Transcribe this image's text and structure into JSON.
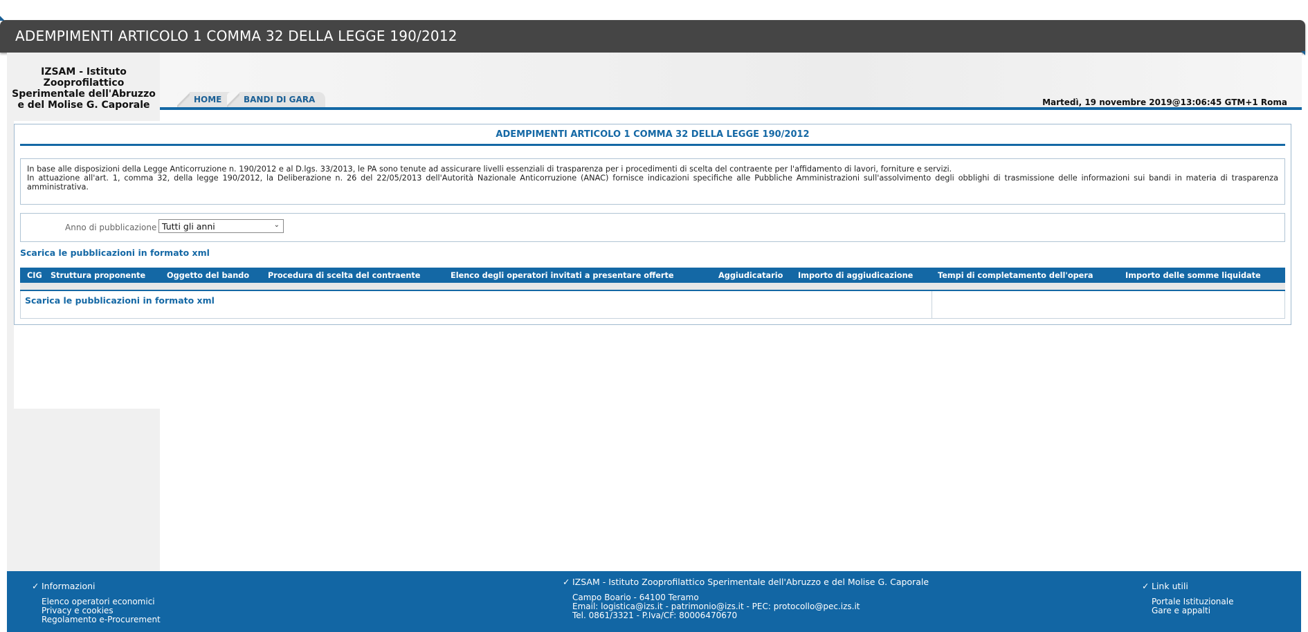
{
  "header": {
    "title": "ADEMPIMENTI ARTICOLO 1 COMMA 32 DELLA LEGGE 190/2012"
  },
  "sidebar": {
    "org_name": "IZSAM - Istituto Zooprofilattico Sperimentale dell'Abruzzo e del Molise G. Caporale"
  },
  "nav": {
    "tabs": [
      {
        "label": "HOME"
      },
      {
        "label": "BANDI DI GARA"
      }
    ],
    "datetime": "Martedì, 19 novembre 2019@13:06:45 GTM+1 Roma"
  },
  "main": {
    "title": "ADEMPIMENTI ARTICOLO 1 COMMA 32 DELLA LEGGE 190/2012",
    "info_line1": "In base alle disposizioni della Legge Anticorruzione n. 190/2012 e al D.lgs. 33/2013, le PA sono tenute ad assicurare livelli essenziali di trasparenza per i procedimenti di scelta del contraente per l'affidamento di lavori, forniture e servizi.",
    "info_line2": "In attuazione all'art. 1, comma 32, della legge 190/2012, la Deliberazione n. 26 del 22/05/2013 dell'Autorità Nazionale Anticorruzione (ANAC) fornisce indicazioni specifiche alle Pubbliche Amministrazioni sull'assolvimento degli obblighi di trasmissione delle informazioni sui bandi in materia di trasparenza amministrativa.",
    "filter": {
      "label": "Anno di pubblicazione",
      "selected": "Tutti gli anni"
    },
    "xml_link": "Scarica le pubblicazioni in formato xml",
    "table": {
      "columns": [
        "CIG",
        "Struttura proponente",
        "Oggetto del bando",
        "Procedura di scelta del contraente",
        "Elenco degli operatori invitati a presentare offerte",
        "Aggiudicatario",
        "Importo di aggiudicazione",
        "Tempi di completamento dell'opera",
        "Importo delle somme liquidate"
      ]
    }
  },
  "footer": {
    "info": {
      "heading": "Informazioni",
      "items": [
        "Elenco operatori economici",
        "Privacy e cookies",
        "Regolamento e-Procurement"
      ]
    },
    "contact": {
      "heading": "IZSAM - Istituto Zooprofilattico Sperimentale dell'Abruzzo e del Molise G. Caporale",
      "lines": [
        "Campo Boario - 64100 Teramo",
        "Email: logistica@izs.it - patrimonio@izs.it - PEC: protocollo@pec.izs.it",
        "Tel. 0861/3321 - P.Iva/CF: 80006470670"
      ]
    },
    "links": {
      "heading": "Link utili",
      "items": [
        "Portale Istituzionale",
        "Gare e appalti"
      ]
    }
  }
}
